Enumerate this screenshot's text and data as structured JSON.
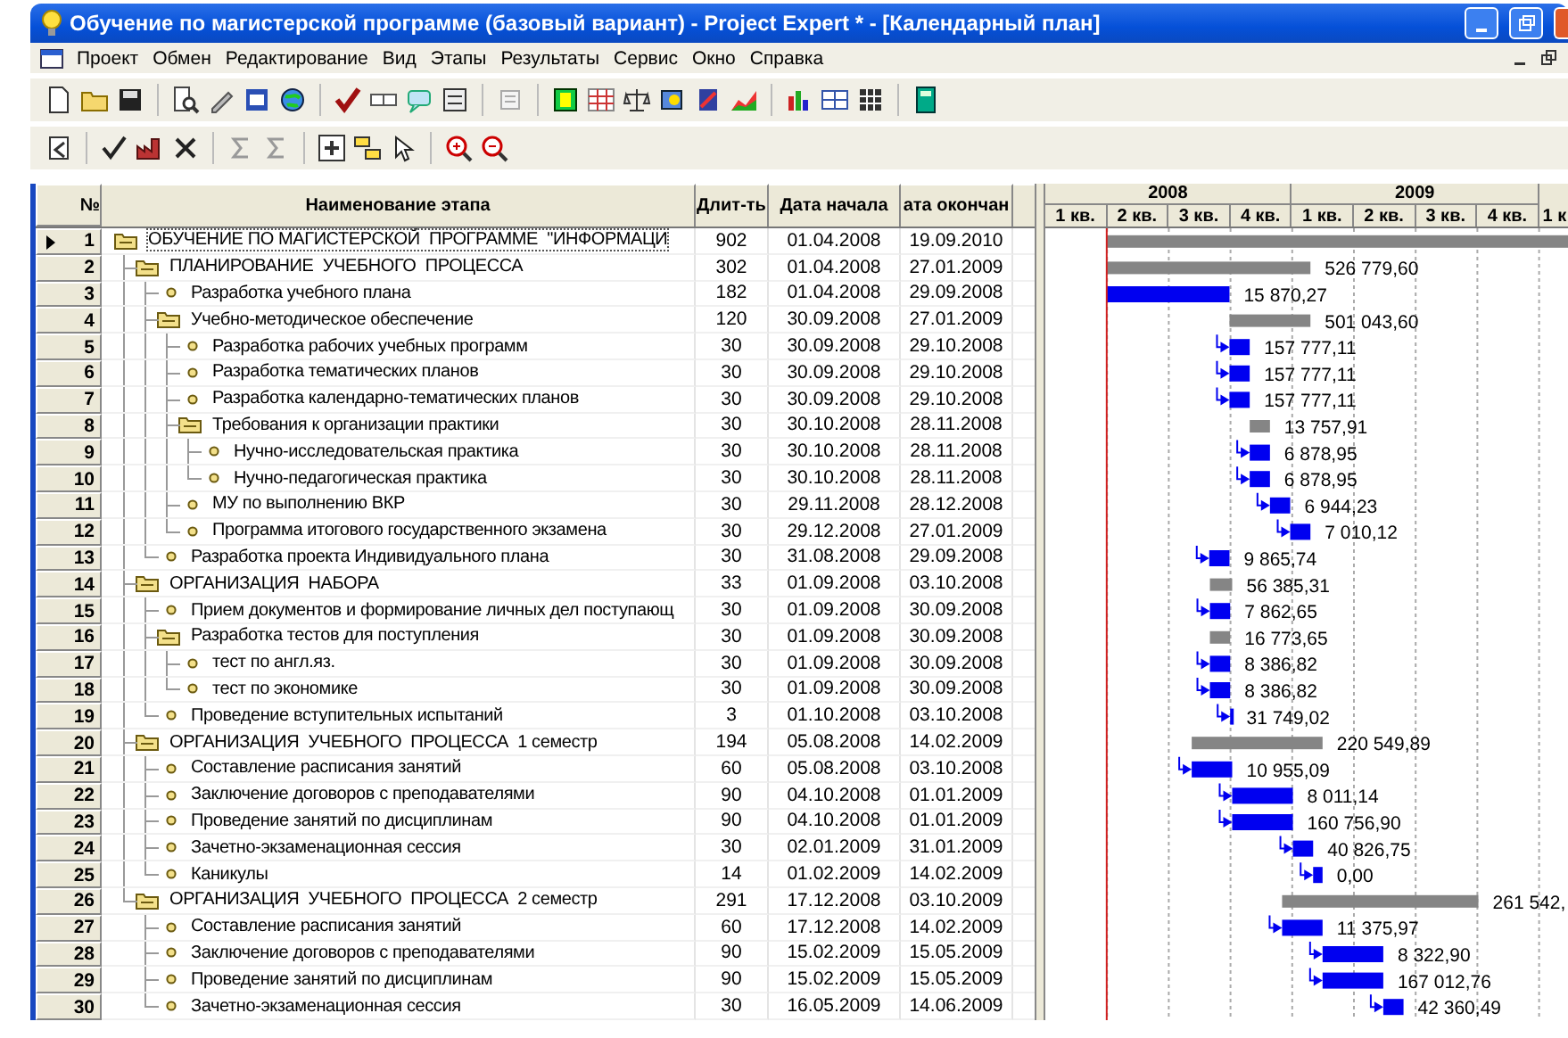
{
  "window": {
    "title": "Обучение по магистерской программе (базовый вариант) - Project Expert * - [Календарный план]"
  },
  "menu": [
    "Проект",
    "Обмен",
    "Редактирование",
    "Вид",
    "Этапы",
    "Результаты",
    "Сервис",
    "Окно",
    "Справка"
  ],
  "table": {
    "columns": [
      "№",
      "Наименование этапа",
      "Длит-ть",
      "Дата начала",
      "ата окончан"
    ],
    "rows": [
      {
        "num": "1",
        "kind": "group",
        "name": "ОБУЧЕНИЕ ПО МАГИСТЕРСКОЙ  ПРОГРАММЕ  \"ИНФОРМАЦИ",
        "duration": "902",
        "start": "01.04.2008",
        "end": "19.09.2010",
        "selected": true,
        "linked": false,
        "children": [
          {
            "num": "2",
            "kind": "group",
            "name": "ПЛАНИРОВАНИЕ  УЧЕБНОГО  ПРОЦЕССА",
            "duration": "302",
            "start": "01.04.2008",
            "end": "27.01.2009",
            "cost": "526 779,60",
            "selected": false,
            "linked": false,
            "children": [
              {
                "num": "3",
                "kind": "task",
                "name": "Разработка учебного плана",
                "duration": "182",
                "start": "01.04.2008",
                "end": "29.09.2008",
                "cost": "15 870,27",
                "selected": false,
                "linked": false
              },
              {
                "num": "4",
                "kind": "group",
                "name": "Учебно-методическое обеспечение",
                "duration": "120",
                "start": "30.09.2008",
                "end": "27.01.2009",
                "cost": "501 043,60",
                "selected": false,
                "linked": false,
                "children": [
                  {
                    "num": "5",
                    "kind": "task",
                    "name": "Разработка рабочих учебных программ",
                    "duration": "30",
                    "start": "30.09.2008",
                    "end": "29.10.2008",
                    "cost": "157 777,11",
                    "selected": false,
                    "linked": true
                  },
                  {
                    "num": "6",
                    "kind": "task",
                    "name": "Разработка тематических планов",
                    "duration": "30",
                    "start": "30.09.2008",
                    "end": "29.10.2008",
                    "cost": "157 777,11",
                    "selected": false,
                    "linked": true
                  },
                  {
                    "num": "7",
                    "kind": "task",
                    "name": "Разработка календарно-тематических планов",
                    "duration": "30",
                    "start": "30.09.2008",
                    "end": "29.10.2008",
                    "cost": "157 777,11",
                    "selected": false,
                    "linked": true
                  },
                  {
                    "num": "8",
                    "kind": "group",
                    "name": "Требования к организации практики",
                    "duration": "30",
                    "start": "30.10.2008",
                    "end": "28.11.2008",
                    "cost": "13 757,91",
                    "selected": false,
                    "linked": false,
                    "children": [
                      {
                        "num": "9",
                        "kind": "task",
                        "name": "Нучно-исследовательская практика",
                        "duration": "30",
                        "start": "30.10.2008",
                        "end": "28.11.2008",
                        "cost": "6 878,95",
                        "selected": false,
                        "linked": true
                      },
                      {
                        "num": "10",
                        "kind": "task",
                        "name": "Нучно-педагогическая практика",
                        "duration": "30",
                        "start": "30.10.2008",
                        "end": "28.11.2008",
                        "cost": "6 878,95",
                        "selected": false,
                        "linked": true
                      }
                    ]
                  },
                  {
                    "num": "11",
                    "kind": "task",
                    "name": "МУ по выполнению ВКР",
                    "duration": "30",
                    "start": "29.11.2008",
                    "end": "28.12.2008",
                    "cost": "6 944,23",
                    "selected": false,
                    "linked": true
                  },
                  {
                    "num": "12",
                    "kind": "task",
                    "name": "Программа итогового государственного экзамена",
                    "duration": "30",
                    "start": "29.12.2008",
                    "end": "27.01.2009",
                    "cost": "7 010,12",
                    "selected": false,
                    "linked": true
                  }
                ]
              },
              {
                "num": "13",
                "kind": "task",
                "name": "Разработка проекта Индивидуального плана",
                "duration": "30",
                "start": "31.08.2008",
                "end": "29.09.2008",
                "cost": "9 865,74",
                "selected": false,
                "linked": true
              }
            ]
          },
          {
            "num": "14",
            "kind": "group",
            "name": "ОРГАНИЗАЦИЯ  НАБОРА",
            "duration": "33",
            "start": "01.09.2008",
            "end": "03.10.2008",
            "cost": "56 385,31",
            "selected": false,
            "linked": false,
            "children": [
              {
                "num": "15",
                "kind": "task",
                "name": "Прием документов и формирование личных дел поступающ",
                "duration": "30",
                "start": "01.09.2008",
                "end": "30.09.2008",
                "cost": "7 862,65",
                "selected": false,
                "linked": true
              },
              {
                "num": "16",
                "kind": "group",
                "name": "Разработка тестов для поступления",
                "duration": "30",
                "start": "01.09.2008",
                "end": "30.09.2008",
                "cost": "16 773,65",
                "selected": false,
                "linked": false,
                "children": [
                  {
                    "num": "17",
                    "kind": "task",
                    "name": "тест по англ.яз.",
                    "duration": "30",
                    "start": "01.09.2008",
                    "end": "30.09.2008",
                    "cost": "8 386,82",
                    "selected": false,
                    "linked": true
                  },
                  {
                    "num": "18",
                    "kind": "task",
                    "name": "тест по экономике",
                    "duration": "30",
                    "start": "01.09.2008",
                    "end": "30.09.2008",
                    "cost": "8 386,82",
                    "selected": false,
                    "linked": true
                  }
                ]
              },
              {
                "num": "19",
                "kind": "task",
                "name": "Проведение вступительных испытаний",
                "duration": "3",
                "start": "01.10.2008",
                "end": "03.10.2008",
                "cost": "31 749,02",
                "selected": false,
                "linked": true
              }
            ]
          },
          {
            "num": "20",
            "kind": "group",
            "name": "ОРГАНИЗАЦИЯ  УЧЕБНОГО  ПРОЦЕССА  1 семестр",
            "duration": "194",
            "start": "05.08.2008",
            "end": "14.02.2009",
            "cost": "220 549,89",
            "selected": false,
            "linked": false,
            "children": [
              {
                "num": "21",
                "kind": "task",
                "name": "Составление расписания занятий",
                "duration": "60",
                "start": "05.08.2008",
                "end": "03.10.2008",
                "cost": "10 955,09",
                "selected": false,
                "linked": true
              },
              {
                "num": "22",
                "kind": "task",
                "name": "Заключение договоров с преподавателями",
                "duration": "90",
                "start": "04.10.2008",
                "end": "01.01.2009",
                "cost": "8 011,14",
                "selected": false,
                "linked": true
              },
              {
                "num": "23",
                "kind": "task",
                "name": "Проведение занятий по дисциплинам",
                "duration": "90",
                "start": "04.10.2008",
                "end": "01.01.2009",
                "cost": "160 756,90",
                "selected": false,
                "linked": true
              },
              {
                "num": "24",
                "kind": "task",
                "name": "Зачетно-экзаменационная сессия",
                "duration": "30",
                "start": "02.01.2009",
                "end": "31.01.2009",
                "cost": "40 826,75",
                "selected": false,
                "linked": true
              },
              {
                "num": "25",
                "kind": "task",
                "name": "Каникулы",
                "duration": "14",
                "start": "01.02.2009",
                "end": "14.02.2009",
                "cost": "0,00",
                "selected": false,
                "linked": true
              }
            ]
          },
          {
            "num": "26",
            "kind": "group",
            "name": "ОРГАНИЗАЦИЯ  УЧЕБНОГО  ПРОЦЕССА  2 семестр",
            "duration": "291",
            "start": "17.12.2008",
            "end": "03.10.2009",
            "cost": "261 542,",
            "selected": false,
            "linked": false,
            "children": [
              {
                "num": "27",
                "kind": "task",
                "name": "Составление расписания занятий",
                "duration": "60",
                "start": "17.12.2008",
                "end": "14.02.2009",
                "cost": "11 375,97",
                "selected": false,
                "linked": true
              },
              {
                "num": "28",
                "kind": "task",
                "name": "Заключение договоров с преподавателями",
                "duration": "90",
                "start": "15.02.2009",
                "end": "15.05.2009",
                "cost": "8 322,90",
                "selected": false,
                "linked": true
              },
              {
                "num": "29",
                "kind": "task",
                "name": "Проведение занятий по дисциплинам",
                "duration": "90",
                "start": "15.02.2009",
                "end": "15.05.2009",
                "cost": "167 012,76",
                "selected": false,
                "linked": true
              },
              {
                "num": "30",
                "kind": "task",
                "name": "Зачетно-экзаменационная сессия",
                "duration": "30",
                "start": "16.05.2009",
                "end": "14.06.2009",
                "cost": "42 360,49",
                "selected": false,
                "linked": true
              }
            ]
          }
        ]
      }
    ]
  },
  "gantt": {
    "years": [
      "2008",
      "2009"
    ],
    "quarters": [
      "1 кв.",
      "2 кв.",
      "3 кв.",
      "4 кв.",
      "1 кв.",
      "2 кв.",
      "3 кв.",
      "4 кв.",
      "1 к"
    ]
  }
}
